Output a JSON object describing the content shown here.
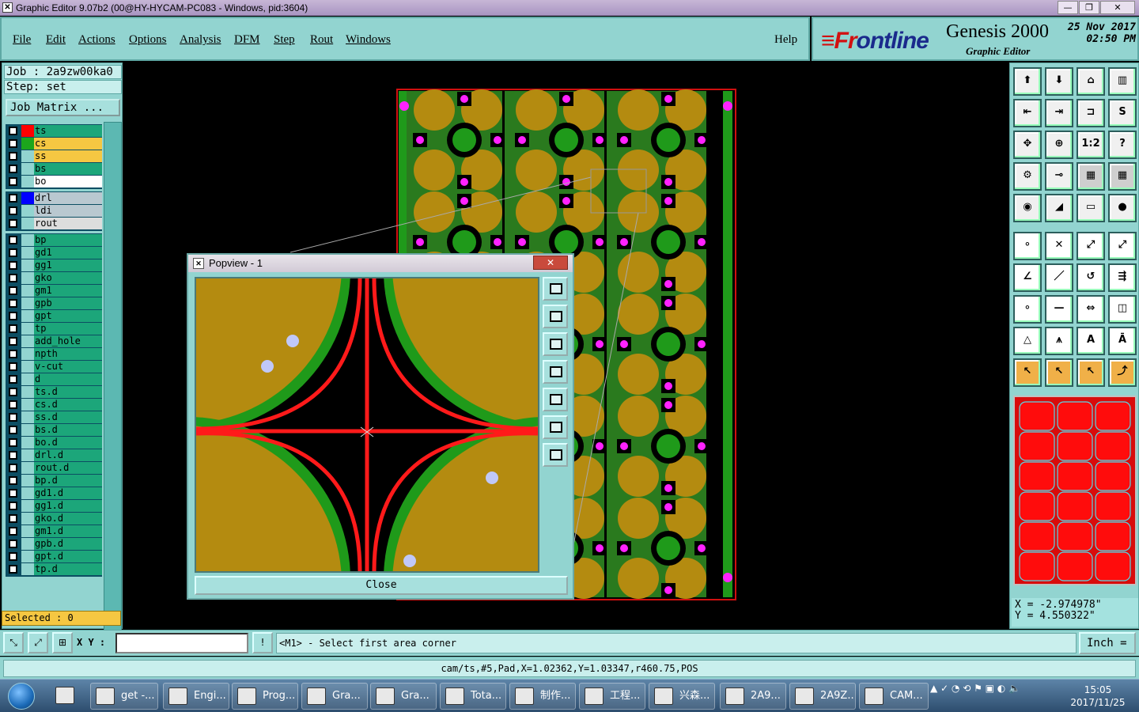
{
  "window": {
    "title": "Graphic Editor 9.07b2 (00@HY-HYCAM-PC083 - Windows, pid:3604)",
    "minimize": "—",
    "restore": "❐",
    "close": "✕"
  },
  "menu": [
    "File",
    "Edit",
    "Actions",
    "Options",
    "Analysis",
    "DFM",
    "Step",
    "Rout",
    "Windows"
  ],
  "help": "Help",
  "brand": {
    "logo_prefix": "≡Fr",
    "logo_rest": "ontline",
    "product": "Genesis 2000",
    "subtitle": "Graphic Editor",
    "date": "25 Nov 2017",
    "time": "02:50 PM"
  },
  "job": {
    "job": "Job : 2a9zw00ka0",
    "step": "Step: set",
    "matrix_button": "Job Matrix ..."
  },
  "layers_group1": [
    {
      "name": "ts",
      "color": "#ff0000",
      "bg": "#1ca67a"
    },
    {
      "name": "cs",
      "color": "#1ca61c",
      "bg": "#f5c742",
      "mark": "▫"
    },
    {
      "name": "ss",
      "color": "",
      "bg": "#f5c742"
    },
    {
      "name": "bs",
      "color": "",
      "bg": "#1ca67a"
    },
    {
      "name": "bo",
      "color": "",
      "bg": "#ffffff"
    }
  ],
  "layers_group2": [
    {
      "name": "drl",
      "color": "#0000ff",
      "bg": "#b9c8d0"
    },
    {
      "name": "ldi",
      "color": "",
      "bg": "#b9c8d0"
    },
    {
      "name": "rout",
      "color": "",
      "bg": "#dddddd"
    }
  ],
  "layers_group3": [
    {
      "name": "bp"
    },
    {
      "name": "gd1"
    },
    {
      "name": "gg1"
    },
    {
      "name": "gko"
    },
    {
      "name": "gm1"
    },
    {
      "name": "gpb"
    },
    {
      "name": "gpt"
    },
    {
      "name": "tp"
    },
    {
      "name": "add_hole"
    },
    {
      "name": "npth"
    },
    {
      "name": "v-cut"
    },
    {
      "name": "d"
    },
    {
      "name": "ts.d"
    },
    {
      "name": "cs.d",
      "mark": "⬋"
    },
    {
      "name": "ss.d",
      "mark": "⬋"
    },
    {
      "name": "bs.d"
    },
    {
      "name": "bo.d",
      "mark": "⬋"
    },
    {
      "name": "drl.d"
    },
    {
      "name": "rout.d"
    },
    {
      "name": "bp.d"
    },
    {
      "name": "gd1.d",
      "mark": "⬋"
    },
    {
      "name": "gg1.d"
    },
    {
      "name": "gko.d"
    },
    {
      "name": "gm1.d"
    },
    {
      "name": "gpb.d"
    },
    {
      "name": "gpt.d"
    },
    {
      "name": "tp.d"
    }
  ],
  "selected": "Selected : 0",
  "popview": {
    "title": "Popview - 1",
    "close_x": "✕",
    "close_button": "Close"
  },
  "coords": {
    "x": "X = -2.974978\"",
    "y": "Y = 4.550322\""
  },
  "cmd": {
    "xy_label": "X Y :",
    "xy_value": "",
    "info_icon": "!",
    "prompt": "<M1> - Select first area corner",
    "unit": "Inch ="
  },
  "status": "cam/ts,#5,Pad,X=1.02362,Y=1.03347,r460.75,POS",
  "taskbar": {
    "items": [
      "get -...",
      "Engi...",
      "Prog...",
      "Gra...",
      "Gra...",
      "Tota...",
      "制作...",
      "工程...",
      "兴森...",
      "2A9...",
      "2A9Z...",
      "CAM..."
    ],
    "time": "15:05",
    "date": "2017/11/25"
  },
  "toolbar_icons": [
    "zoom-home",
    "zoom-in-page",
    "zoom-tree",
    "split-view",
    "pan-left",
    "pan-right",
    "mirror-view",
    "curve",
    "fit-all",
    "center",
    "ratio",
    "help",
    "layer-props",
    "rout-tool",
    "panel-layers",
    "panel-layers-2",
    "snap",
    "draw-line",
    "measure",
    "circle",
    "connect",
    "intersect",
    "point-line",
    "point-line-2",
    "angle",
    "slash",
    "arc",
    "array",
    "pad",
    "minus",
    "resize",
    "shapes",
    "triangle",
    "triangle-up",
    "triangle-a",
    "triangle-b",
    "select",
    "select-box",
    "select-circle",
    "select-path"
  ]
}
